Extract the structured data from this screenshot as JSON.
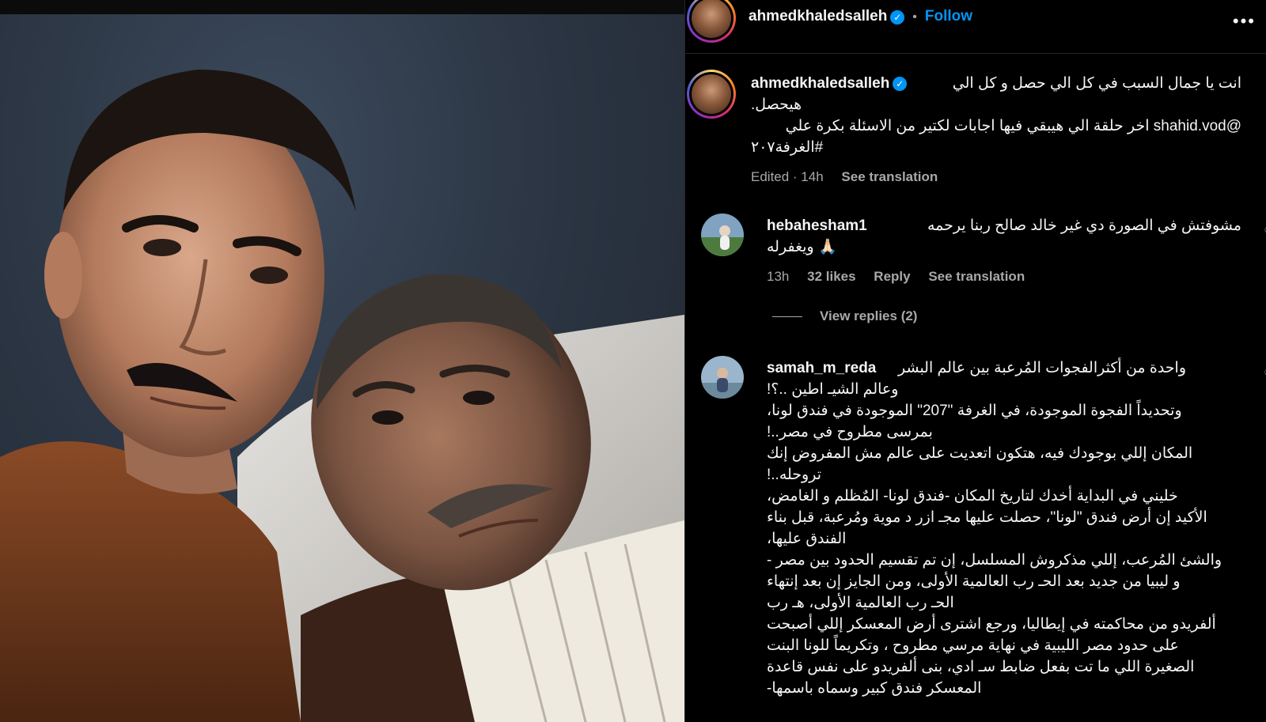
{
  "post": {
    "author": "ahmedkhaledsalleh",
    "follow_label": "Follow",
    "more_label": "•••",
    "dot": "•"
  },
  "caption": {
    "author": "ahmedkhaledsalleh",
    "line1": "انت يا جمال السبب في كل الي حصل و كل الي",
    "line2": "هيحصل.",
    "line3": "@shahid.vod اخر حلقة الي هيبقي فيها اجابات لكتير من الاسئلة بكرة علي",
    "line4": "#الغرفة٢٠٧",
    "edited": "Edited · 14h",
    "see_translation": "See translation"
  },
  "comments": [
    {
      "author": "hebahesham1",
      "text1": "مشوفتش في الصورة دي غير خالد صالح ربنا يرحمه",
      "text2": "🙏🏻 ويغفرله",
      "time": "13h",
      "likes": "32 likes",
      "reply": "Reply",
      "see_translation": "See translation",
      "view_replies": "View replies (2)"
    },
    {
      "author": "samah_m_reda",
      "lines": [
        "واحدة من أكثرالفجوات المُرعبة بين عالم البشر",
        "وعالم الشيـ اطين ..؟!",
        "وتحديداً الفجوة الموجودة، في الغرفة \"207\" الموجودة في فندق لونا،",
        "بمرسى مطروح في مصر..!",
        "المكان إللي بوجودك فيه، هتكون اتعديت على عالم مش المفروض إنك",
        "تروحله..!",
        "خليني في البداية أخدك لتاريخ المكان -فندق لونا- المٌظلم و الغامض،",
        "الأكيد إن أرض فندق \"لونا\"، حصلت عليها مجـ ازر د موية ومُرعبة، قبل بناء",
        "الفندق عليها،",
        "والشئ المُرعب، إللي مذكروش المسلسل، إن تم تقسيم الحدود بين مصر -",
        "و ليبيا من جديد بعد الحـ رب العالمية الأولى، ومن الجايز إن بعد إنتهاء",
        "الحـ رب العالمية الأولى، هـ رب",
        "ألفريدو من محاكمته في إيطاليا، ورجع اشترى أرض المعسكر إللي أصبحت",
        "على حدود مصر الليبية في نهاية مرسي مطروح ، وتكريماً للونا البنت",
        "الصغيرة اللي ما تت بفعل ضابط سـ ادي، بنى ألفريدو على نفس قاعدة",
        "المعسكر فندق كبير وسماه باسمها-"
      ]
    }
  ],
  "icons": {
    "verified": "verified-badge-icon",
    "heart": "heart-icon",
    "more": "more-options-icon"
  },
  "colors": {
    "link": "#0095f6",
    "secondary": "#a8a8a8",
    "background": "#000000"
  }
}
